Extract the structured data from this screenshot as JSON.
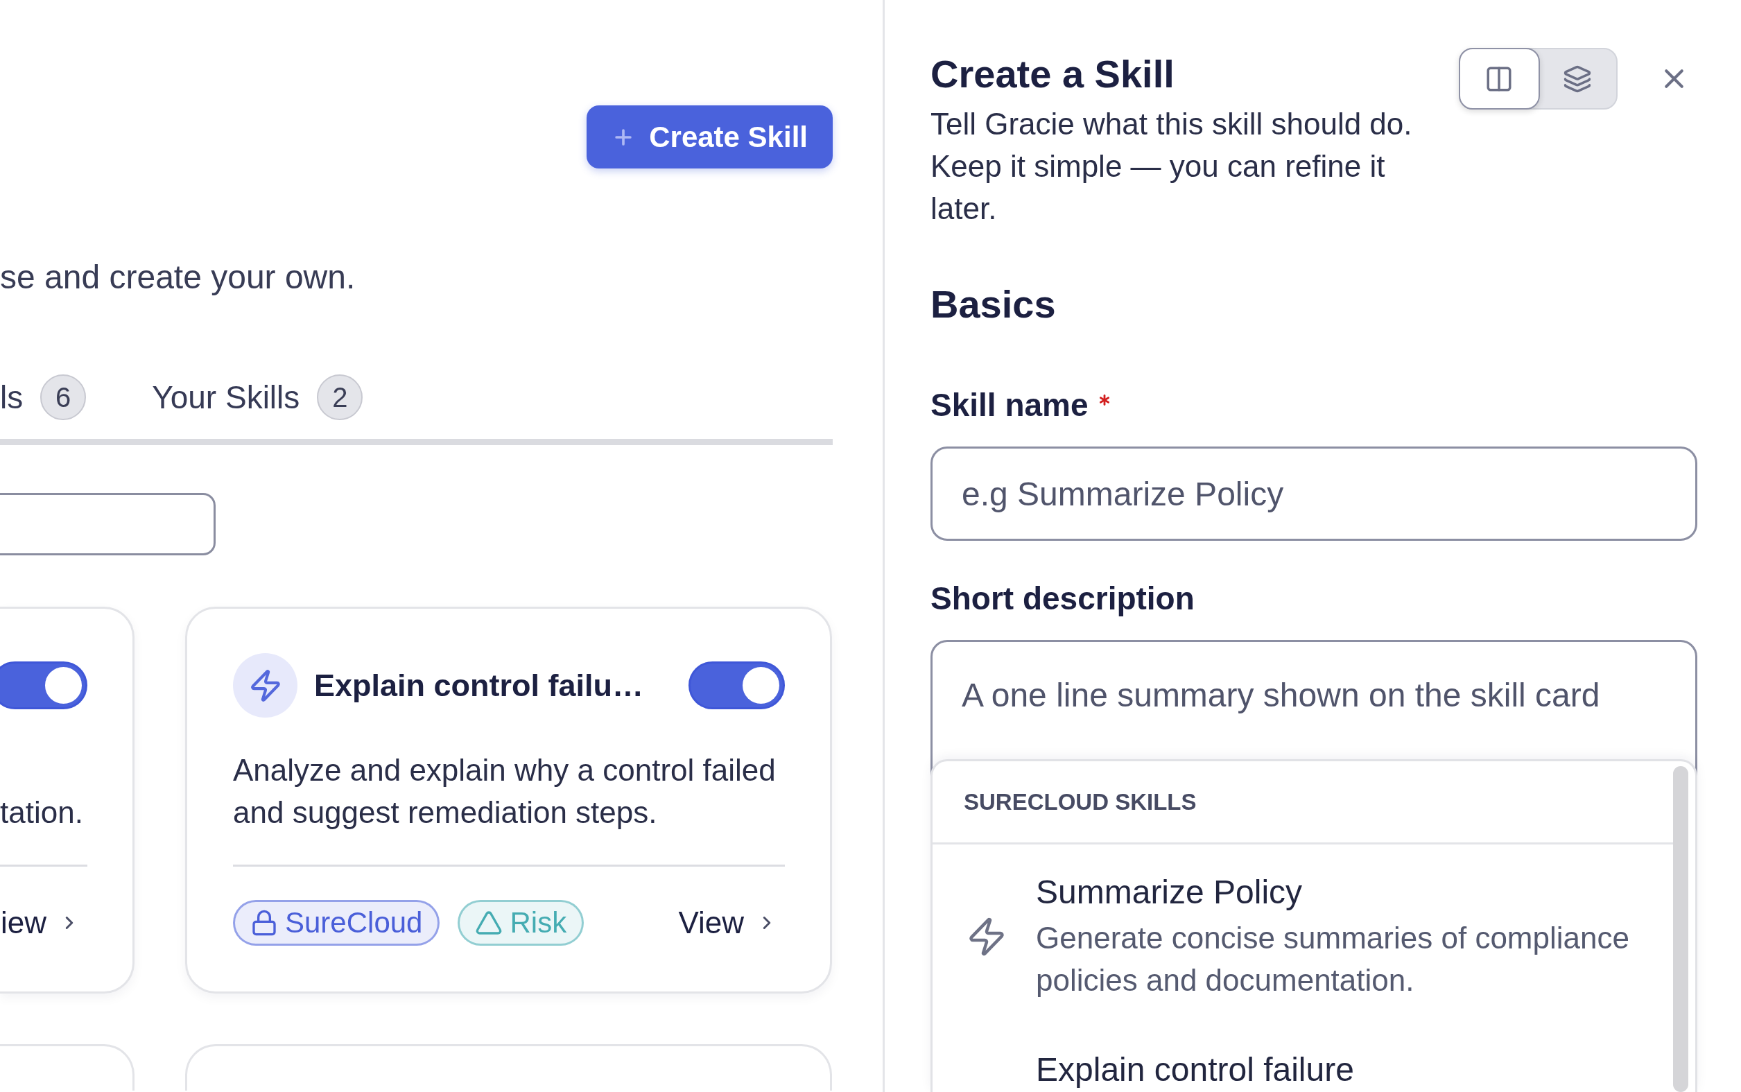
{
  "main": {
    "create_button": "Create Skill",
    "subtitle": "se and create your own.",
    "tabs": [
      {
        "label": "ls",
        "count": "6"
      },
      {
        "label": "Your Skills",
        "count": "2"
      }
    ],
    "cards": [
      {
        "enabled": true,
        "description": "tation.",
        "link": "iew"
      },
      {
        "title": "Explain control failu…",
        "enabled": true,
        "description": "Analyze and explain why a control failed and suggest remediation steps.",
        "tags": [
          {
            "kind": "lock",
            "label": "SureCloud",
            "color": "#4a5fd9"
          },
          {
            "kind": "triangle",
            "label": "Risk",
            "color": "#45acb2"
          }
        ],
        "link": "View"
      }
    ]
  },
  "panel": {
    "title": "Create a Skill",
    "subtitle": "Tell Gracie what this skill should do. Keep it simple — you can refine it later.",
    "view_modes": [
      {
        "kind": "split",
        "selected": true
      },
      {
        "kind": "layers",
        "selected": false
      }
    ],
    "section": "Basics",
    "fields": [
      {
        "kind": "input",
        "label": "Skill name",
        "required": true,
        "placeholder": "e.g Summarize Policy"
      },
      {
        "kind": "textarea",
        "label": "Short description",
        "required": false,
        "placeholder": "A one line summary shown on the skill card"
      }
    ],
    "suggestions": {
      "heading": "SURECLOUD SKILLS",
      "items": [
        {
          "title": "Summarize Policy",
          "description": "Generate concise summaries of compliance policies and documentation."
        },
        {
          "title": "Explain control failure"
        }
      ]
    }
  }
}
